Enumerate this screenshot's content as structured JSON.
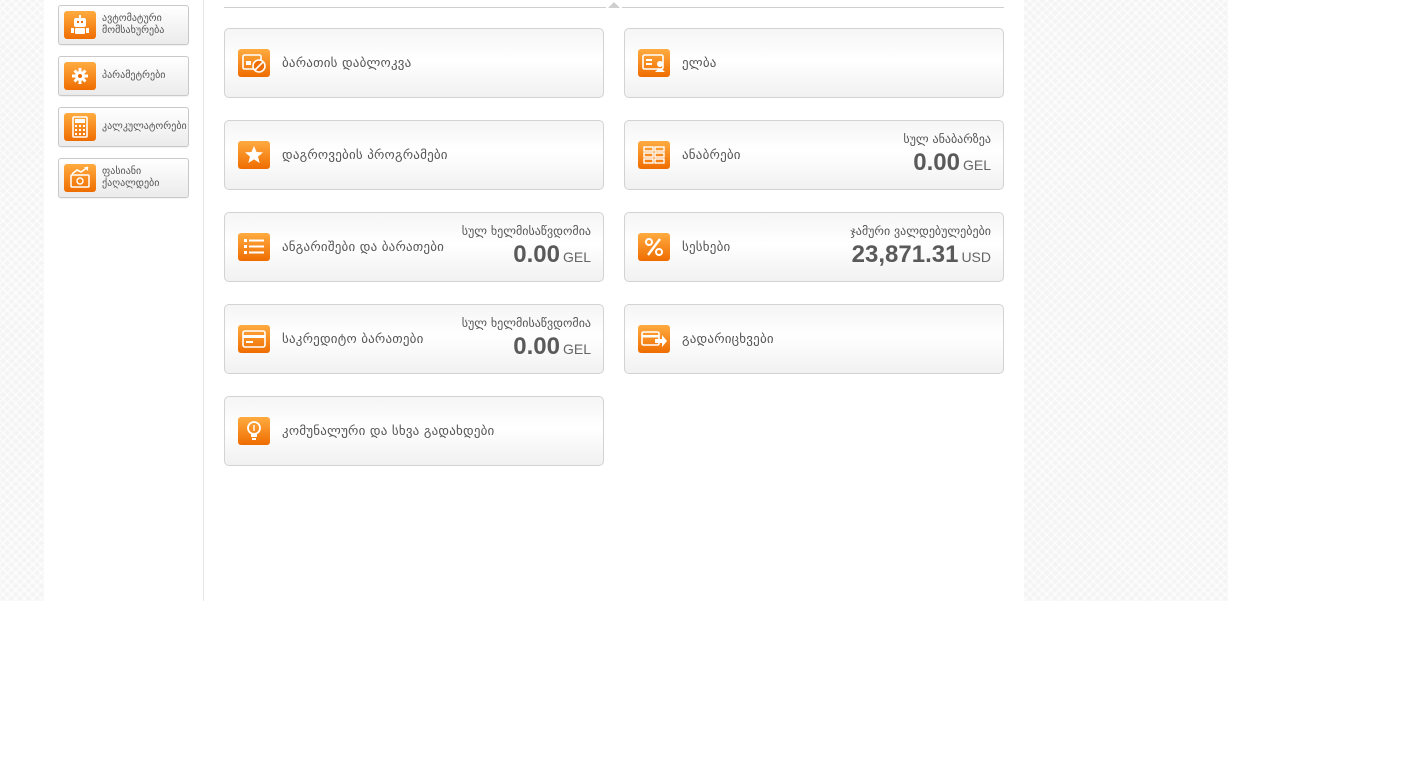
{
  "sidebar": {
    "items": [
      {
        "label": "ავტომატური\nმომსახურება",
        "icon": "robot-icon"
      },
      {
        "label": "პარამეტრები",
        "icon": "gear-icon"
      },
      {
        "label": "კალკულატორები",
        "icon": "calculator-icon"
      },
      {
        "label": "ფასიანი\nქაღალდები",
        "icon": "securities-chart-icon"
      }
    ]
  },
  "tiles": {
    "card_block": {
      "title": "ბარათის დაბლოკვა",
      "icon": "card-block-icon"
    },
    "elba": {
      "title": "ელბა",
      "icon": "elba-icon"
    },
    "rewards": {
      "title": "დაგროვების პროგრამები",
      "icon": "star-icon"
    },
    "deposits": {
      "title": "ანაბრები",
      "icon": "deposits-icon",
      "caption": "სულ ანაბარზეა",
      "amount": "0.00",
      "currency": "GEL"
    },
    "accounts": {
      "title": "ანგარიშები და ბარათები",
      "icon": "list-icon",
      "caption": "სულ ხელმისაწვდომია",
      "amount": "0.00",
      "currency": "GEL"
    },
    "loans": {
      "title": "სესხები",
      "icon": "percent-icon",
      "caption": "ჯამური ვალდებულებები",
      "amount": "23,871.31",
      "currency": "USD"
    },
    "credit_cards": {
      "title": "საკრედიტო ბარათები",
      "icon": "credit-card-icon",
      "caption": "სულ ხელმისაწვდომია",
      "amount": "0.00",
      "currency": "GEL"
    },
    "transfers": {
      "title": "გადარიცხვები",
      "icon": "transfer-icon"
    },
    "utilities": {
      "title": "კომუნალური და სხვა გადახდები",
      "icon": "lightbulb-icon"
    }
  },
  "colors": {
    "accent": "#f58a1f",
    "accent_dark": "#ef6d00",
    "text": "#555555",
    "border": "#d3d3d3"
  }
}
